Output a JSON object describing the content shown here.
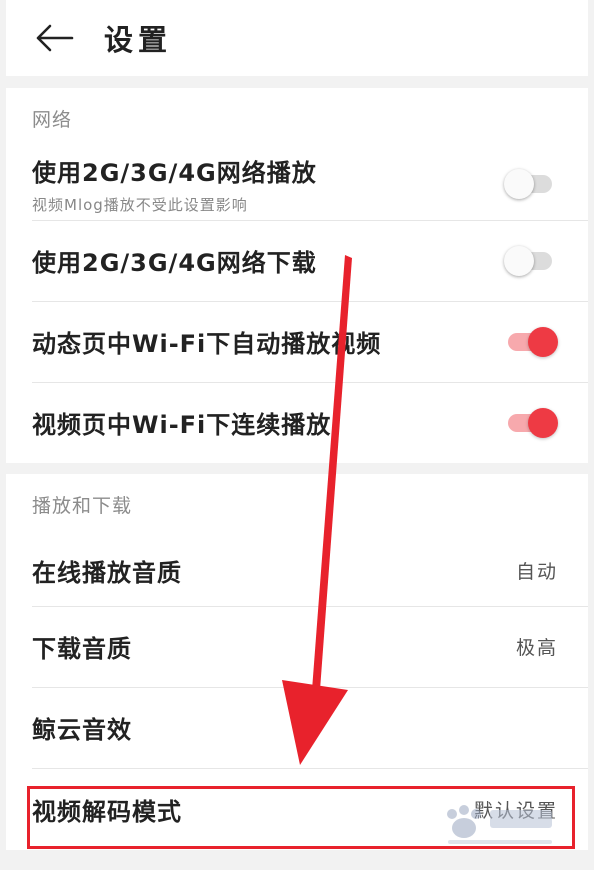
{
  "header": {
    "back_icon": "arrow-left-icon",
    "title": "设置"
  },
  "sections": {
    "network": {
      "title": "网络",
      "rows": [
        {
          "label": "使用2G/3G/4G网络播放",
          "sub": "视频Mlog播放不受此设置影响",
          "toggle_on": false
        },
        {
          "label": "使用2G/3G/4G网络下载",
          "toggle_on": false
        },
        {
          "label": "动态页中Wi-Fi下自动播放视频",
          "toggle_on": true
        },
        {
          "label": "视频页中Wi-Fi下连续播放",
          "toggle_on": true
        }
      ]
    },
    "playback": {
      "title": "播放和下载",
      "rows": [
        {
          "label": "在线播放音质",
          "value": "自动"
        },
        {
          "label": "下载音质",
          "value": "极高"
        },
        {
          "label": "鲸云音效",
          "value": ""
        },
        {
          "label": "视频解码模式",
          "value": "默认设置"
        }
      ]
    }
  },
  "colors": {
    "accent": "#ee3a44",
    "accent_track": "#f7a9ad",
    "annotation": "#e8222c"
  },
  "annotation": {
    "arrow_icon": "red-arrow-annotation",
    "highlight": "highlight-box"
  }
}
